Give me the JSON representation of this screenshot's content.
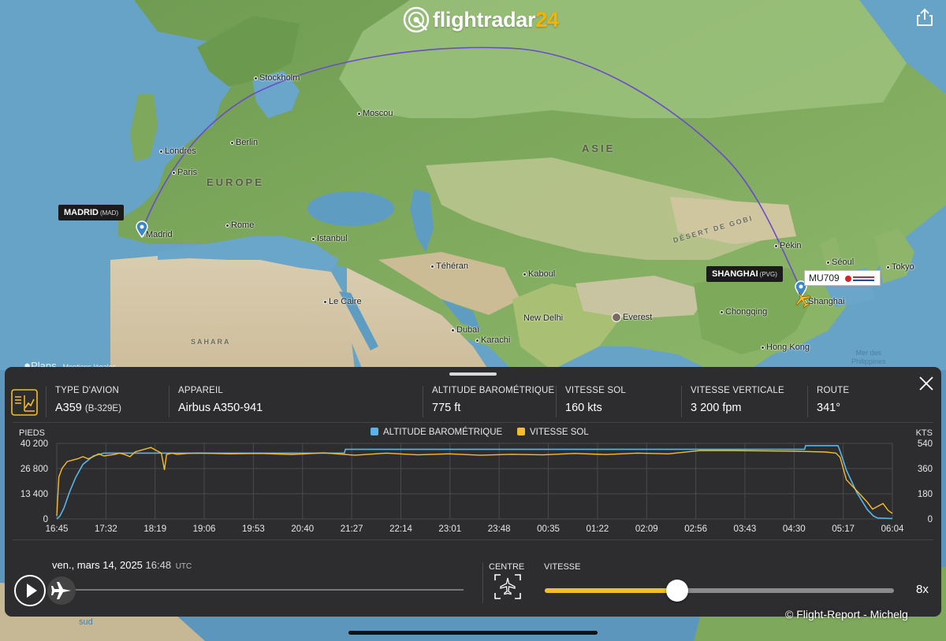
{
  "brand": {
    "name": "flightradar",
    "num": "24"
  },
  "map": {
    "regions": [
      {
        "id": "europe",
        "text": "EUROPE"
      },
      {
        "id": "asie",
        "text": "ASIE"
      },
      {
        "id": "sahara",
        "text": "SAHARA"
      },
      {
        "id": "gobi",
        "text": "DÉSERT DE GOBI"
      }
    ],
    "seas": {
      "philippines": "Mer des\nPhilippines",
      "sud": "sud"
    },
    "cities": [
      {
        "id": "stockholm",
        "name": "Stockholm"
      },
      {
        "id": "moscou",
        "name": "Moscou"
      },
      {
        "id": "londres",
        "name": "Londres"
      },
      {
        "id": "berlin",
        "name": "Berlin"
      },
      {
        "id": "paris",
        "name": "Paris"
      },
      {
        "id": "madrid",
        "name": "Madrid"
      },
      {
        "id": "rome",
        "name": "Rome"
      },
      {
        "id": "istanbul",
        "name": "Istanbul"
      },
      {
        "id": "teheran",
        "name": "Téhéran"
      },
      {
        "id": "kaboul",
        "name": "Kaboul"
      },
      {
        "id": "le-caire",
        "name": "Le Caire"
      },
      {
        "id": "dubai",
        "name": "Dubaï"
      },
      {
        "id": "karachi",
        "name": "Karachi"
      },
      {
        "id": "new-delhi",
        "name": "New Delhi"
      },
      {
        "id": "everest",
        "name": "Everest"
      },
      {
        "id": "pekin",
        "name": "Pékin"
      },
      {
        "id": "seoul",
        "name": "Séoul"
      },
      {
        "id": "tokyo",
        "name": "Tokyo"
      },
      {
        "id": "shanghai",
        "name": "Shanghai"
      },
      {
        "id": "chongqing",
        "name": "Chongqing"
      },
      {
        "id": "hong-kong",
        "name": "Hong Kong"
      }
    ],
    "origin": {
      "name": "MADRID",
      "code": "(MAD)"
    },
    "destination": {
      "name": "SHANGHAI",
      "code": "(PVG)"
    },
    "flight_tag": {
      "callsign": "MU709"
    },
    "apple_maps": {
      "label": "Plans",
      "legal": "Mentions légales"
    }
  },
  "info": {
    "type_avion": {
      "label": "TYPE D'AVION",
      "value": "A359",
      "sub": "(B-329E)"
    },
    "appareil": {
      "label": "APPAREIL",
      "value": "Airbus A350-941"
    },
    "altitude": {
      "label": "ALTITUDE BAROMÉTRIQUE",
      "value": "775 ft"
    },
    "vitesse_sol": {
      "label": "VITESSE SOL",
      "value": "160 kts"
    },
    "vitesse_verticale": {
      "label": "VITESSE VERTICALE",
      "value": "3 200 fpm"
    },
    "route": {
      "label": "ROUTE",
      "value": "341°"
    }
  },
  "chart_data": {
    "type": "line",
    "title": "",
    "ylabel_left": "PIEDS",
    "ylabel_right": "KTS",
    "yticks_left": [
      "40 200",
      "26 800",
      "13 400",
      "0"
    ],
    "yticks_right": [
      "540",
      "360",
      "180",
      "0"
    ],
    "ylim_left": [
      0,
      40200
    ],
    "ylim_right": [
      0,
      540
    ],
    "x_ticks": [
      "16:45",
      "17:32",
      "18:19",
      "19:06",
      "19:53",
      "20:40",
      "21:27",
      "22:14",
      "23:01",
      "23:48",
      "00:35",
      "01:22",
      "02:09",
      "02:56",
      "03:43",
      "04:30",
      "05:17",
      "06:04"
    ],
    "colors": {
      "altitude": "#5ab4e8",
      "speed": "#f5bd2b"
    },
    "series": [
      {
        "name": "ALTITUDE BAROMÉTRIQUE",
        "x": [
          "16:45",
          "16:48",
          "16:52",
          "16:57",
          "17:03",
          "17:10",
          "17:20",
          "17:30",
          "17:50",
          "18:30",
          "19:30",
          "20:30",
          "21:10",
          "21:20",
          "21:21",
          "22:00",
          "23:00",
          "00:00",
          "01:00",
          "02:00",
          "02:56",
          "03:30",
          "04:30",
          "04:40",
          "04:41",
          "05:00",
          "05:12",
          "05:14",
          "05:20",
          "05:30",
          "05:40",
          "05:46",
          "05:50",
          "06:04"
        ],
        "values": [
          0,
          1500,
          6000,
          14000,
          22000,
          29000,
          33500,
          35000,
          35000,
          35000,
          35000,
          35000,
          35000,
          35000,
          37000,
          37000,
          37000,
          37000,
          37000,
          37000,
          37000,
          37000,
          37000,
          37000,
          39000,
          39000,
          39000,
          36000,
          26000,
          14000,
          5000,
          1500,
          500,
          200
        ]
      },
      {
        "name": "VITESSE SOL",
        "x": [
          "16:45",
          "16:46",
          "16:47",
          "16:50",
          "16:55",
          "17:00",
          "17:05",
          "17:10",
          "17:15",
          "17:20",
          "17:25",
          "17:30",
          "17:35",
          "17:40",
          "17:45",
          "17:50",
          "17:55",
          "18:00",
          "18:05",
          "18:10",
          "18:15",
          "18:20",
          "18:25",
          "18:28",
          "18:30",
          "18:35",
          "18:40",
          "18:50",
          "19:00",
          "19:30",
          "20:00",
          "20:30",
          "21:00",
          "21:30",
          "22:00",
          "22:30",
          "23:00",
          "23:30",
          "00:00",
          "00:30",
          "01:00",
          "01:30",
          "02:00",
          "02:30",
          "03:00",
          "03:30",
          "04:00",
          "04:30",
          "05:00",
          "05:10",
          "05:14",
          "05:20",
          "05:30",
          "05:40",
          "05:45",
          "05:50",
          "05:55",
          "06:00",
          "06:04"
        ],
        "values": [
          20,
          160,
          300,
          360,
          410,
          420,
          430,
          445,
          430,
          445,
          465,
          450,
          455,
          460,
          470,
          460,
          445,
          480,
          490,
          500,
          510,
          490,
          470,
          350,
          460,
          470,
          462,
          468,
          470,
          465,
          468,
          460,
          472,
          455,
          470,
          458,
          465,
          455,
          462,
          458,
          468,
          460,
          470,
          465,
          488,
          488,
          486,
          484,
          478,
          470,
          440,
          280,
          200,
          120,
          70,
          90,
          110,
          60,
          40
        ]
      }
    ]
  },
  "playback": {
    "date": "ven., mars 14, 2025",
    "time": "16:48",
    "tz": "UTC",
    "centre_label": "CENTRE",
    "speed_label": "VITESSE",
    "speed_fraction": 0.38,
    "speed_value": "8x",
    "timeline_fraction": 0.0
  },
  "credit": "© Flight-Report - Michelg"
}
